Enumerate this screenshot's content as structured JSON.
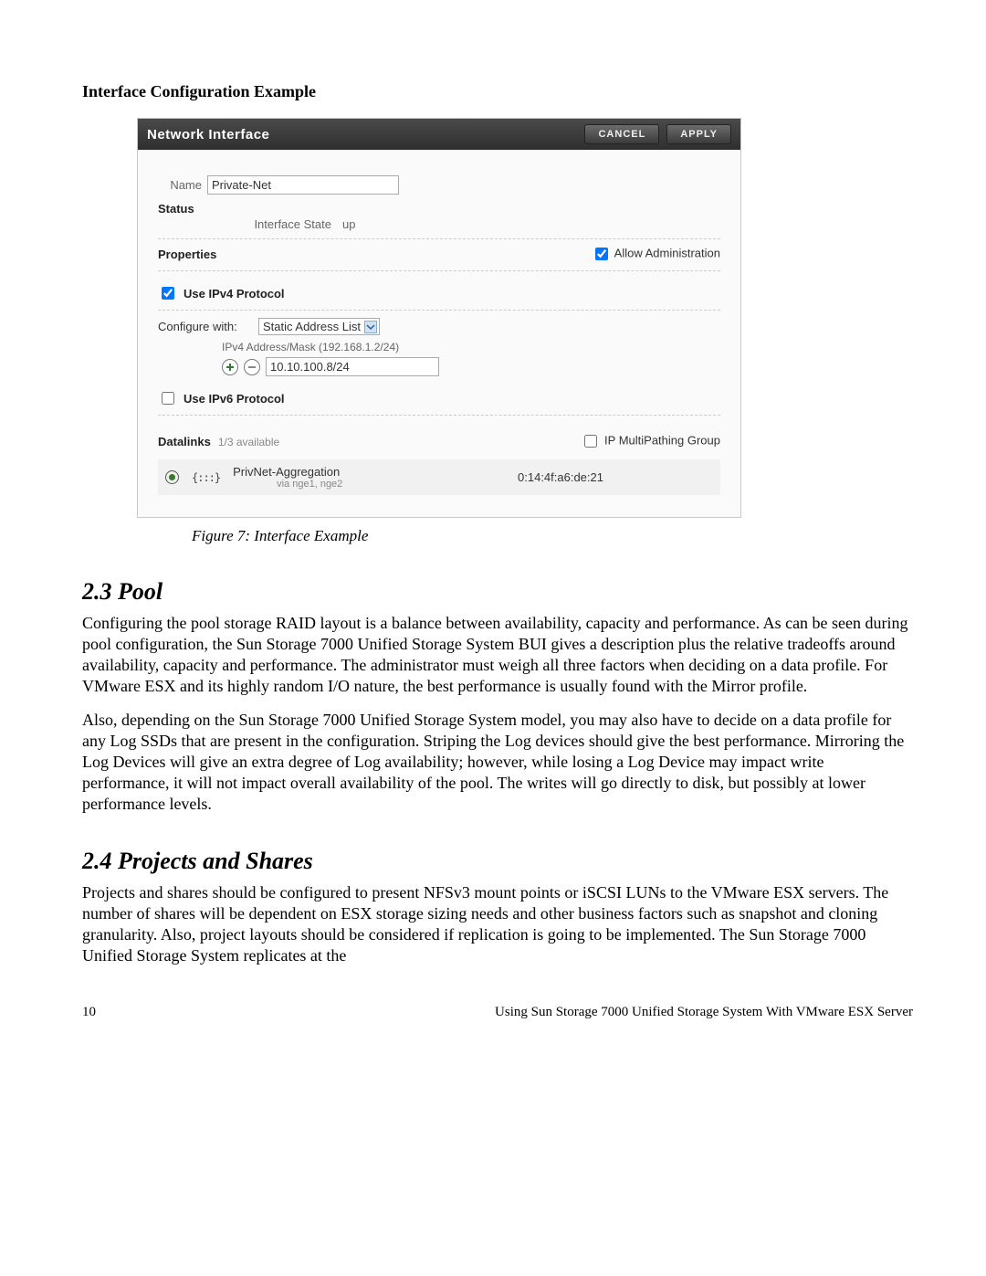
{
  "doc": {
    "sectionHeading": "Interface Configuration Example",
    "figureCaption": "Figure 7: Interface Example",
    "pool": {
      "heading": "2.3 Pool",
      "p1": "Configuring the pool storage RAID layout is a balance between availability, capacity and performance. As can be seen during pool configuration, the Sun Storage 7000 Unified Storage System BUI gives a description plus the relative tradeoffs around availability, capacity and performance. The administrator must weigh all three factors when deciding on a data profile. For VMware ESX and its highly random I/O nature, the best performance is usually found with the Mirror profile.",
      "p2": "Also, depending on the Sun Storage 7000 Unified Storage System model, you may also have to decide on a data profile for any Log SSDs that are present in the configuration. Striping the Log devices should give the best performance. Mirroring the Log Devices will give an extra degree of Log availability; however, while losing a Log Device may impact write performance, it will not impact overall availability of the pool. The writes will go directly to disk, but possibly at lower performance levels."
    },
    "projects": {
      "heading": "2.4 Projects and Shares",
      "p1": "Projects and shares should be configured to present NFSv3 mount points or iSCSI LUNs to the VMware ESX servers. The number of shares will be dependent on ESX storage sizing needs and other business factors such as snapshot and cloning granularity. Also, project layouts should be considered if replication is going to be implemented. The Sun Storage 7000 Unified Storage System replicates at the"
    },
    "pageNumber": "10",
    "footerTitle": "Using Sun Storage 7000 Unified Storage System With VMware ESX Server"
  },
  "dialog": {
    "title": "Network Interface",
    "cancel": "CANCEL",
    "apply": "APPLY",
    "nameLabel": "Name",
    "nameValue": "Private-Net",
    "statusTitle": "Status",
    "interfaceStateLabel": "Interface State",
    "interfaceStateValue": "up",
    "propertiesTitle": "Properties",
    "allowAdmin": "Allow Administration",
    "useIpv4": "Use IPv4 Protocol",
    "configureLabel": "Configure with:",
    "configureMode": "Static Address List",
    "addrHint": "IPv4 Address/Mask (192.168.1.2/24)",
    "addrValue": "10.10.100.8/24",
    "useIpv6": "Use IPv6 Protocol",
    "datalinksTitle": "Datalinks",
    "datalinksSub": "1/3 available",
    "ipmpLabel": "IP MultiPathing Group",
    "linkName": "PrivNet-Aggregation",
    "linkVia": "via nge1, nge2",
    "linkMac": "0:14:4f:a6:de:21"
  }
}
